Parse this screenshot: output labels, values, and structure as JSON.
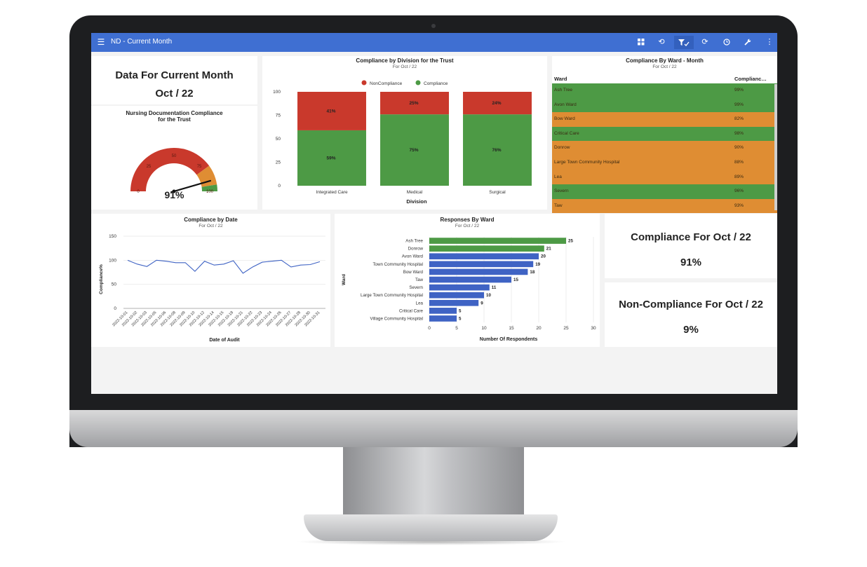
{
  "app": {
    "title": "ND - Current Month",
    "toolbar_icons": [
      "grid-icon",
      "undo-icon",
      "filter-check-icon",
      "refresh-icon",
      "clock-icon",
      "wrench-icon",
      "more-vert-icon"
    ]
  },
  "colors": {
    "topbar": "#3f6fd2",
    "red": "#c9392c",
    "green": "#4d9a45",
    "orange": "#df8d33",
    "blue": "#3f63c4"
  },
  "header_card": {
    "title": "Data For Current Month",
    "period": "Oct / 22"
  },
  "gauge": {
    "title_line1": "Nursing Documentation Compliance",
    "title_line2": "for the Trust",
    "value": 91,
    "value_label": "91%",
    "min": 0,
    "max": 100,
    "ticks": [
      "0",
      "25",
      "50",
      "75",
      "100"
    ],
    "bands": [
      {
        "from": 0,
        "to": 80,
        "color": "#c9392c"
      },
      {
        "from": 80,
        "to": 95,
        "color": "#df8d33"
      },
      {
        "from": 95,
        "to": 100,
        "color": "#4d9a45"
      }
    ]
  },
  "division_chart": {
    "title": "Compliance by Division for the Trust",
    "subtitle": "For Oct / 22",
    "legend": [
      "NonCompliance",
      "Compliance"
    ],
    "xlabel": "Division",
    "yticks": [
      "0",
      "25",
      "50",
      "75",
      "100"
    ]
  },
  "ward_table": {
    "title": "Compliance By Ward - Month",
    "subtitle": "For Oct / 22",
    "col_ward": "Ward",
    "col_compliance": "Complianc…",
    "rows": [
      {
        "ward": "Ash Tree",
        "value": "99%",
        "color": "#4d9a45"
      },
      {
        "ward": "Avon Ward",
        "value": "99%",
        "color": "#4d9a45"
      },
      {
        "ward": "Bow Ward",
        "value": "82%",
        "color": "#df8d33"
      },
      {
        "ward": "Critical Care",
        "value": "98%",
        "color": "#4d9a45"
      },
      {
        "ward": "Donrow",
        "value": "90%",
        "color": "#df8d33"
      },
      {
        "ward": "Large Town Community Hospital",
        "value": "88%",
        "color": "#df8d33"
      },
      {
        "ward": "Lea",
        "value": "89%",
        "color": "#df8d33"
      },
      {
        "ward": "Severn",
        "value": "96%",
        "color": "#4d9a45"
      },
      {
        "ward": "Taw",
        "value": "93%",
        "color": "#df8d33"
      }
    ]
  },
  "date_chart": {
    "title": "Compliance by Date",
    "subtitle": "For Oct / 22",
    "xlabel": "Date of Audit",
    "ylabel": "Compliance%",
    "yticks": [
      "0",
      "50",
      "100",
      "150"
    ]
  },
  "responses_chart": {
    "title": "Responses By Ward",
    "subtitle": "For Oct / 22",
    "xlabel": "Number Of Respondents",
    "ylabel": "Ward",
    "xticks": [
      "0",
      "5",
      "10",
      "15",
      "20",
      "25",
      "30"
    ]
  },
  "compliance_card": {
    "title": "Compliance For Oct / 22",
    "value": "91%"
  },
  "noncompliance_card": {
    "title": "Non-Compliance For Oct / 22",
    "value": "9%"
  },
  "chart_data": [
    {
      "type": "bar",
      "stacked": true,
      "title": "Compliance by Division for the Trust",
      "subtitle": "For Oct / 22",
      "categories": [
        "Integrated Care",
        "Medical",
        "Surgical"
      ],
      "series": [
        {
          "name": "Compliance",
          "values": [
            59,
            76,
            76
          ],
          "labels": [
            "59%",
            "75%",
            "76%"
          ],
          "color": "#4d9a45"
        },
        {
          "name": "NonCompliance",
          "values": [
            41,
            24,
            24
          ],
          "labels": [
            "41%",
            "25%",
            "24%"
          ],
          "color": "#c9392c"
        }
      ],
      "xlabel": "Division",
      "ylim": [
        0,
        100
      ],
      "legend": "top"
    },
    {
      "type": "line",
      "title": "Compliance by Date",
      "subtitle": "For Oct / 22",
      "x": [
        "2022-10-01",
        "2022-10-02",
        "2022-10-03",
        "2022-10-05",
        "2022-10-06",
        "2022-10-08",
        "2022-10-09",
        "2022-10-10",
        "2022-10-12",
        "2022-10-14",
        "2022-10-15",
        "2022-10-18",
        "2022-10-21",
        "2022-10-22",
        "2022-10-23",
        "2022-10-24",
        "2022-10-26",
        "2022-10-27",
        "2022-10-28",
        "2022-10-30",
        "2022-10-31"
      ],
      "y": [
        100,
        92,
        87,
        100,
        98,
        95,
        95,
        77,
        98,
        90,
        92,
        99,
        73,
        86,
        96,
        98,
        100,
        86,
        90,
        91,
        97
      ],
      "xlabel": "Date of Audit",
      "ylabel": "Compliance%",
      "ylim": [
        0,
        150
      ],
      "grid": true
    },
    {
      "type": "bar",
      "orientation": "horizontal",
      "title": "Responses By Ward",
      "subtitle": "For Oct / 22",
      "categories": [
        "Ash Tree",
        "Donrow",
        "Avon Ward",
        "Town Community Hospital",
        "Bow Ward",
        "Taw",
        "Severn",
        "Large Town Community Hospital",
        "Lea",
        "Critical Care",
        "Village Community Hospital"
      ],
      "values": [
        25,
        21,
        20,
        19,
        18,
        15,
        11,
        10,
        9,
        5,
        5
      ],
      "colors": [
        "#4d9a45",
        "#4d9a45",
        "#3f63c4",
        "#3f63c4",
        "#3f63c4",
        "#3f63c4",
        "#3f63c4",
        "#3f63c4",
        "#3f63c4",
        "#3f63c4",
        "#3f63c4"
      ],
      "xlabel": "Number Of Respondents",
      "ylabel": "Ward",
      "xlim": [
        0,
        30
      ],
      "grid": true
    }
  ]
}
